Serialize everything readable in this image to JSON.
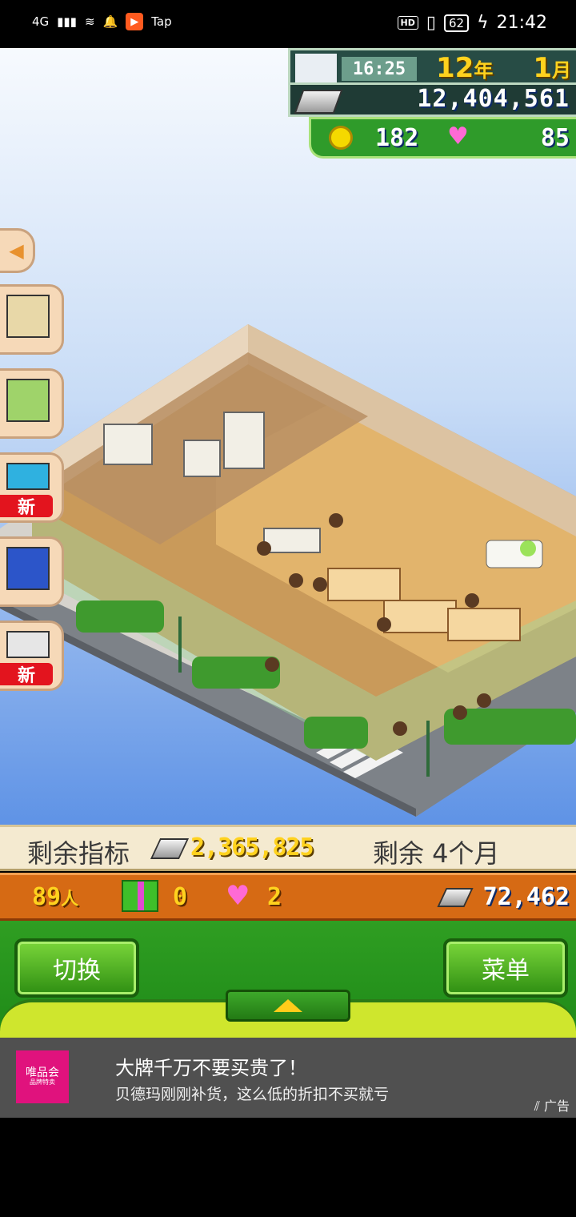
{
  "status_bar": {
    "network": "4G",
    "tap_label": "Tap",
    "battery": "62",
    "hd_label": "HD",
    "time": "21:42"
  },
  "hud": {
    "clock_time": "16:25",
    "year_value": "12",
    "year_unit": "年",
    "month_value": "1",
    "month_unit": "月",
    "money": "12,404,561",
    "medals": "182",
    "hearts": "85"
  },
  "side_menu": {
    "new_badge_1": "新",
    "new_badge_2": "新"
  },
  "quota_bar": {
    "label": "剩余指标",
    "value": "2,365,825",
    "remaining": "剩余 4个月"
  },
  "stats_bar": {
    "visitors": "89",
    "visitors_unit": "人",
    "gifts": "0",
    "hearts": "2",
    "money": "72,462"
  },
  "controls": {
    "switch_label": "切换",
    "menu_label": "菜单"
  },
  "ad": {
    "logo_text": "唯品会",
    "logo_sub": "品牌特卖",
    "title": "大牌千万不要买贵了！",
    "subtitle": "贝德玛刚刚补货，这么低的折扣不买就亏",
    "mark": "广告"
  },
  "colors": {
    "gold": "#ffd21e",
    "green": "#2f9e22",
    "orange_bar": "#d66a14",
    "sky": "#5f93e6"
  }
}
